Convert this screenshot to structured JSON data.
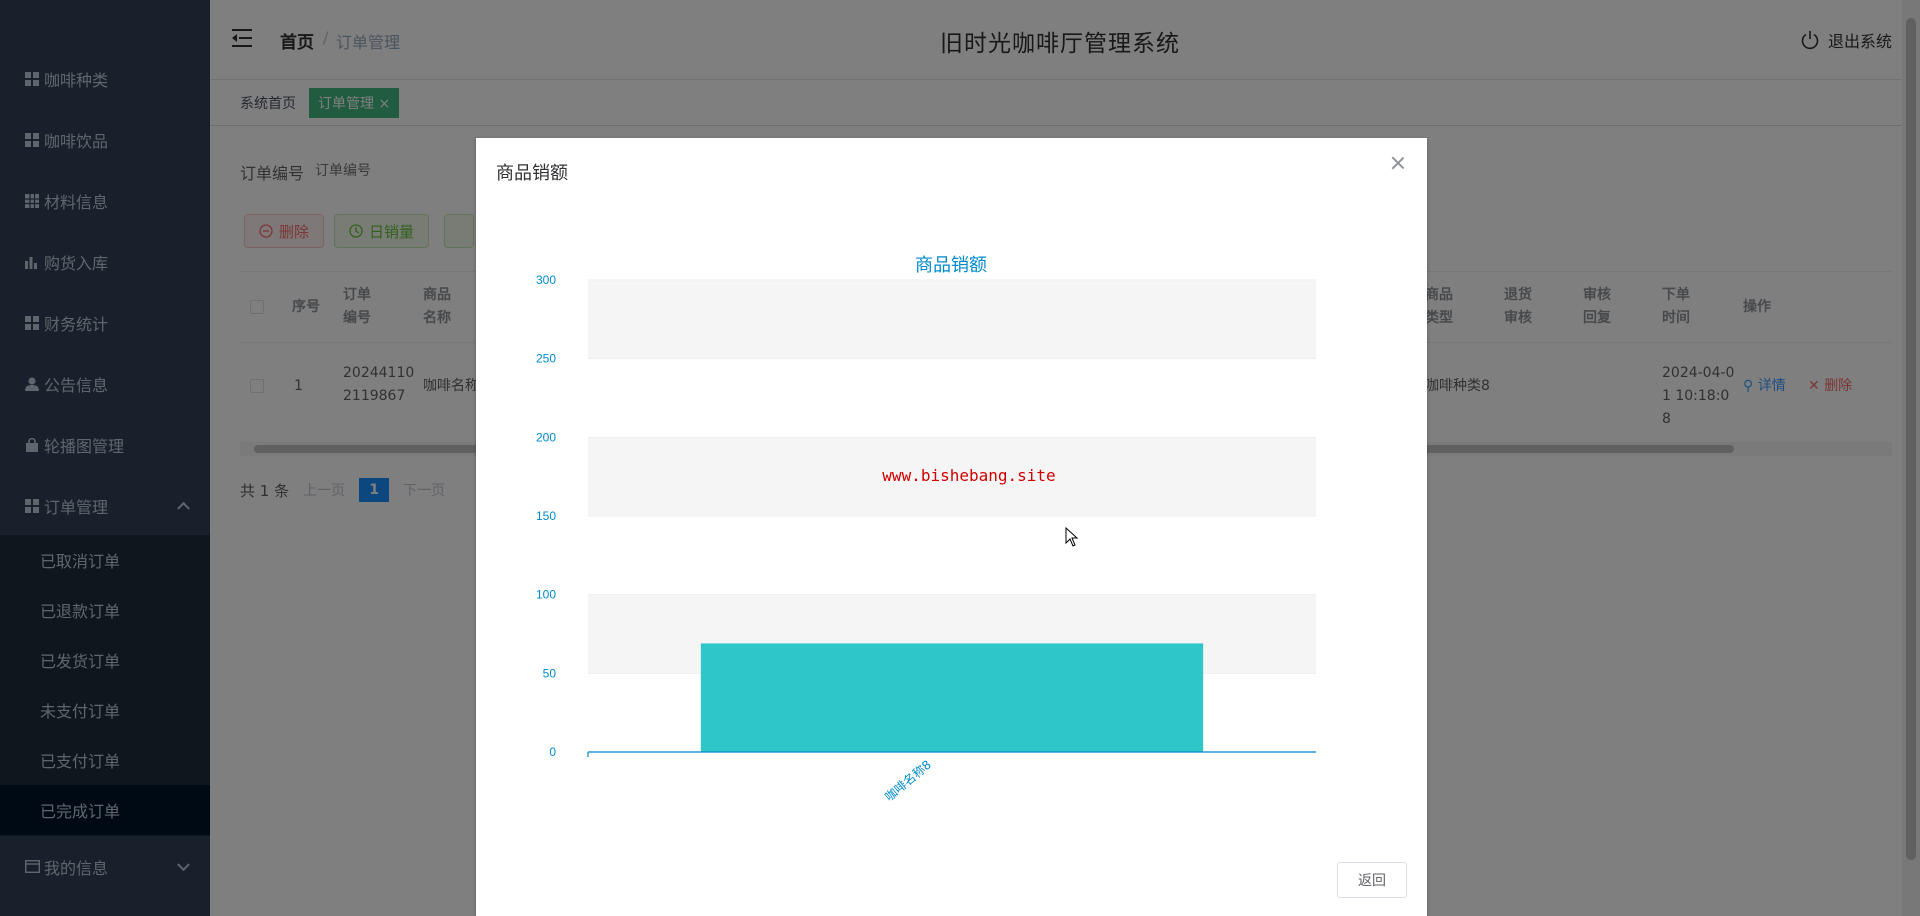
{
  "sidebar": {
    "items": [
      {
        "label": "咖啡种类",
        "icon": "grid-icon"
      },
      {
        "label": "咖啡饮品",
        "icon": "grid-icon"
      },
      {
        "label": "材料信息",
        "icon": "table-icon"
      },
      {
        "label": "购货入库",
        "icon": "bar-chart-icon"
      },
      {
        "label": "财务统计",
        "icon": "grid-icon"
      },
      {
        "label": "公告信息",
        "icon": "user-icon"
      },
      {
        "label": "轮播图管理",
        "icon": "lock-icon"
      },
      {
        "label": "订单管理",
        "icon": "grid-icon"
      }
    ],
    "submenu": [
      "已取消订单",
      "已退款订单",
      "已发货订单",
      "未支付订单",
      "已支付订单",
      "已完成订单"
    ],
    "my_info": "我的信息"
  },
  "header": {
    "home": "首页",
    "current": "订单管理",
    "title": "旧时光咖啡厅管理系统",
    "logout": "退出系统"
  },
  "tags": {
    "home": "系统首页",
    "active": "订单管理 ×"
  },
  "search": {
    "label": "订单编号",
    "placeholder": "订单编号"
  },
  "actions": {
    "delete": "删除",
    "daily_sales": "日销量"
  },
  "table": {
    "headers": [
      "序号",
      "订单编号",
      "商品名称",
      "商品类型",
      "退货审核",
      "审核回复",
      "下单时间",
      "操作"
    ],
    "row": {
      "index": "1",
      "order_no": "202441102119867",
      "goods_name": "咖啡名称",
      "goods_type": "咖啡种类8",
      "order_time": "2024-04-01 10:18:08",
      "detail": "详情",
      "delete": "删除"
    }
  },
  "pager": {
    "total": "共 1 条",
    "prev": "上一页",
    "page": "1",
    "next": "下一页"
  },
  "dialog": {
    "title": "商品销额",
    "back": "返回"
  },
  "watermark": "www.bishebang.site",
  "colors": {
    "bar": "#2ec7c9",
    "axis": "#008acd",
    "sidebar": "#304156",
    "tag_active": "#42b983"
  },
  "chart_data": {
    "type": "bar",
    "title": "商品销额",
    "categories": [
      "咖啡名称8"
    ],
    "values": [
      69
    ],
    "ylim": [
      0,
      300
    ],
    "yticks": [
      0,
      50,
      100,
      150,
      200,
      250,
      300
    ],
    "grid": true
  }
}
